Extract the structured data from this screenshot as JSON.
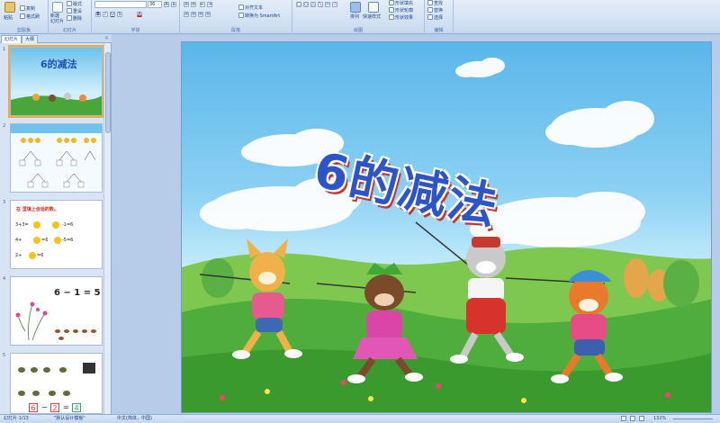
{
  "ribbon": {
    "clipboard": {
      "paste": "粘贴",
      "copy": "复制",
      "format_painter": "格式刷",
      "label": "剪贴板"
    },
    "slides": {
      "new_slide": "新建\n幻灯片",
      "layout": "版式",
      "reset": "重设",
      "delete": "删除",
      "label": "幻灯片"
    },
    "font": {
      "size": "36",
      "label": "字体"
    },
    "paragraph": {
      "align_text": "对齐文本",
      "convert_smartart": "转换为 SmartArt",
      "label": "段落"
    },
    "drawing": {
      "arrange": "排列",
      "quick_styles": "快速样式",
      "shape_fill": "形状填充",
      "shape_outline": "形状轮廓",
      "shape_effects": "形状效果",
      "label": "绘图"
    },
    "editing": {
      "find": "查找",
      "replace": "替换",
      "select": "选择",
      "label": "编辑"
    }
  },
  "left_panel": {
    "tabs": [
      "幻灯片",
      "大纲"
    ],
    "close": "×",
    "slides": [
      {
        "num": "1",
        "title": "6的减法"
      },
      {
        "num": "2",
        "title": ""
      },
      {
        "num": "3",
        "title": "在 里填上合适的数。",
        "lines": [
          "3+3=",
          "-1=6",
          "4+",
          "=6",
          "-5=6",
          "2+",
          "=6"
        ]
      },
      {
        "num": "4",
        "equation": "6 − 1 = 5"
      },
      {
        "num": "5",
        "equation": [
          "6",
          "−",
          "2",
          "=",
          "4"
        ]
      }
    ]
  },
  "slide": {
    "title": "6的减法"
  },
  "statusbar": {
    "slide_info": "幻灯片 1/13",
    "theme": "\"默认设计模板\"",
    "language": "中文(简体，中国)",
    "zoom": "132%"
  }
}
